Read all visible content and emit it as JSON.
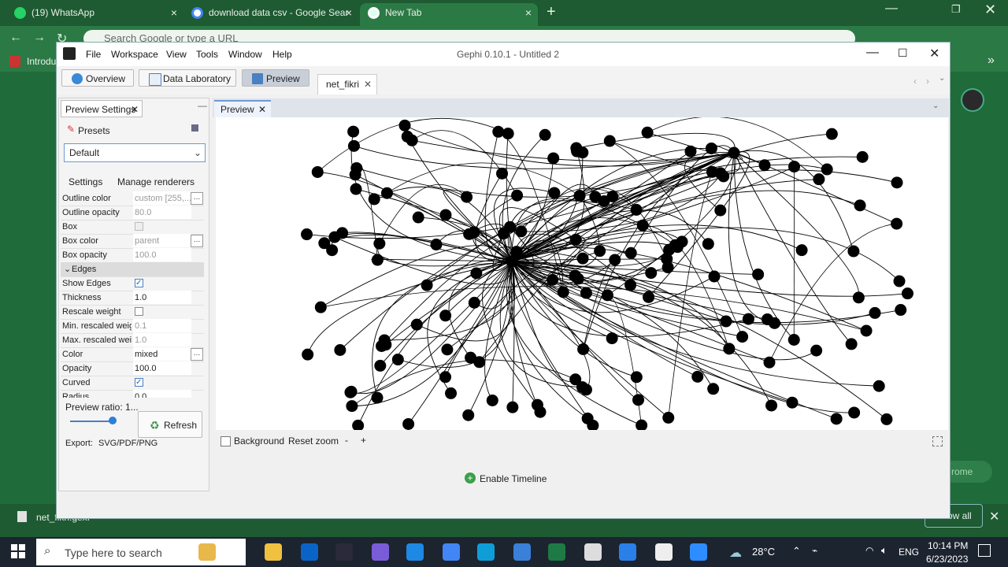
{
  "chrome": {
    "tabs": [
      {
        "label": "(19) WhatsApp",
        "x": "×"
      },
      {
        "label": "download data csv - Google Sear",
        "x": "×"
      },
      {
        "label": "New Tab",
        "x": "×"
      }
    ],
    "new_tab": "+",
    "omnibox_placeholder": "Search Google or type a URL",
    "bookmark": "Introduc",
    "bookmarks_more": "»"
  },
  "gephi": {
    "title": "Gephi 0.10.1 - Untitled 2",
    "menu": [
      "File",
      "Workspace",
      "View",
      "Tools",
      "Window",
      "Help"
    ],
    "modes": [
      "Overview",
      "Data Laboratory",
      "Preview"
    ],
    "project_tab": "net_fikri",
    "preview_settings_tab": "Preview Settings",
    "presets_label": "Presets",
    "preset_value": "Default",
    "subtabs": [
      "Settings",
      "Manage renderers"
    ],
    "properties": [
      {
        "label": "Outline color",
        "value": "custom [255,...",
        "kind": "dots",
        "dim": true
      },
      {
        "label": "Outline opacity",
        "value": "80.0",
        "kind": "text",
        "dim": true
      },
      {
        "label": "Box",
        "value": "",
        "kind": "check-disabled"
      },
      {
        "label": "Box color",
        "value": "parent",
        "kind": "dots",
        "dim": true
      },
      {
        "label": "Box opacity",
        "value": "100.0",
        "kind": "text",
        "dim": true
      }
    ],
    "edges_section": "Edges",
    "edge_properties": [
      {
        "label": "Show Edges",
        "value": "",
        "kind": "check-on"
      },
      {
        "label": "Thickness",
        "value": "1.0",
        "kind": "text"
      },
      {
        "label": "Rescale weight",
        "value": "",
        "kind": "check-off"
      },
      {
        "label": "Min. rescaled weight",
        "value": "0.1",
        "kind": "text",
        "dim": true
      },
      {
        "label": "Max. rescaled weight",
        "value": "1.0",
        "kind": "text",
        "dim": true
      },
      {
        "label": "Color",
        "value": "mixed",
        "kind": "dots"
      },
      {
        "label": "Opacity",
        "value": "100.0",
        "kind": "text"
      },
      {
        "label": "Curved",
        "value": "",
        "kind": "check-on"
      },
      {
        "label": "Radius",
        "value": "0.0",
        "kind": "text"
      }
    ],
    "preview_ratio": "Preview ratio: 1...",
    "preview_ratio_level": 1.0,
    "refresh": "Refresh",
    "export_label": "Export:",
    "export_formats": "SVG/PDF/PNG",
    "preview_tab": "Preview",
    "background_label": "Background",
    "reset_zoom": "Reset zoom",
    "zoom_out": "-",
    "zoom_in": "+",
    "enable_timeline": "Enable Timeline"
  },
  "taskbar": {
    "search_placeholder": "Type here to search",
    "weather": "28°C",
    "lang": "ENG",
    "time": "10:14 PM",
    "date": "6/23/2023"
  },
  "background_app": {
    "file": "net_fikri.gexf",
    "show_all": "Show all",
    "chrome_label": "rome"
  },
  "colors": {
    "accent": "#6b9bd1",
    "chrome_green": "#2b7a45"
  }
}
